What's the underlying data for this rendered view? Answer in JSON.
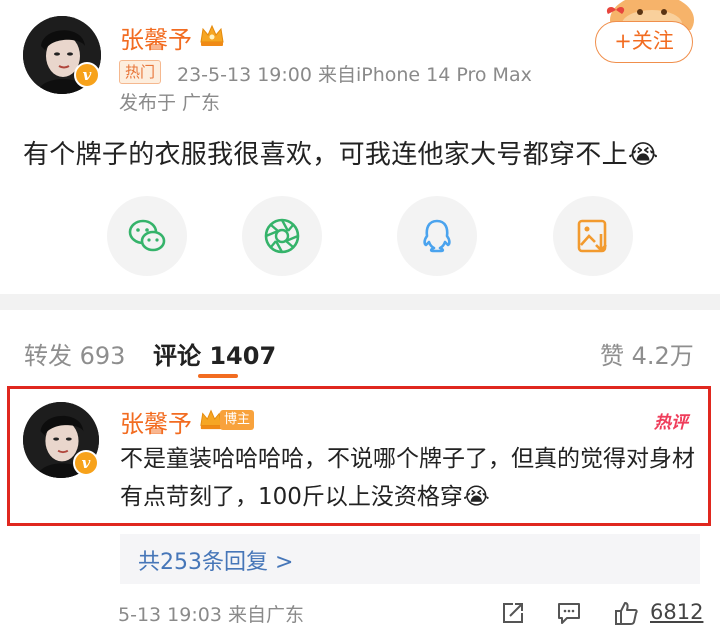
{
  "post": {
    "author": "张馨予",
    "hot_tag": "热门",
    "meta": "23-5-13 19:00  来自iPhone 14 Pro Max",
    "location": "发布于 广东",
    "follow_label": "+关注",
    "text": "有个牌子的衣服我很喜欢，可我连他家大号都穿不上😭"
  },
  "share": {
    "icons": [
      "wechat-icon",
      "moments-icon",
      "qq-icon",
      "save-image-icon"
    ]
  },
  "tabs": {
    "repost": "转发 693",
    "comments": "评论 1407",
    "likes": "赞 4.2万"
  },
  "comment": {
    "author": "张馨予",
    "host_tag": "博主",
    "hot_tag": "热评",
    "text": "不是童装哈哈哈哈，不说哪个牌子了，但真的觉得对身材有点苛刻了，100斤以上没资格穿😭",
    "replies_link": "共253条回复 >",
    "meta": "5-13 19:03  来自广东",
    "like_count": "6812"
  },
  "colors": {
    "accent": "#f26c21",
    "highlight_border": "#e0281f",
    "link": "#4676b8"
  }
}
